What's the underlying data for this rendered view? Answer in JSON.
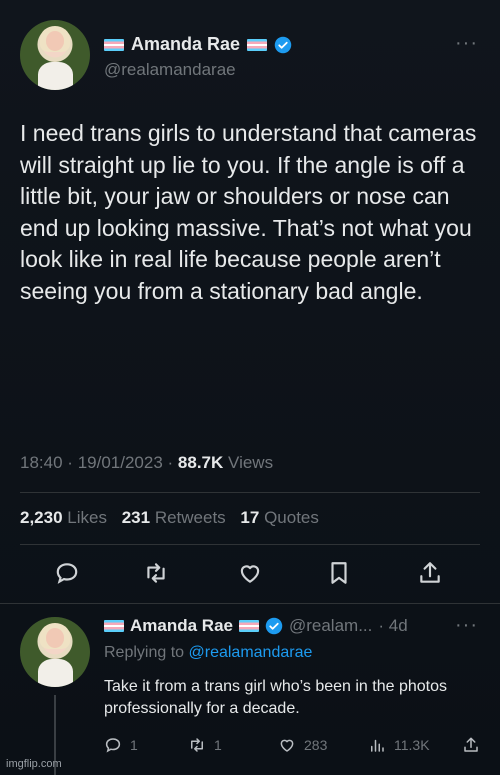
{
  "main_tweet": {
    "display_name": "Amanda Rae",
    "handle": "@realamandarae",
    "text": "I need trans girls to understand that cameras will straight up lie to you. If the angle is off a little bit, your jaw or shoulders or nose can end up looking massive. That’s not what you look like in real life because people aren’t seeing you from a stationary bad angle.",
    "time": "18:40",
    "date": "19/01/2023",
    "views_count": "88.7K",
    "views_label": "Views",
    "likes_count": "2,230",
    "likes_label": "Likes",
    "retweets_count": "231",
    "retweets_label": "Retweets",
    "quotes_count": "17",
    "quotes_label": "Quotes",
    "more_icon": "more-icon",
    "actions": [
      "reply-icon",
      "retweet-icon",
      "like-icon",
      "bookmark-icon",
      "share-icon"
    ]
  },
  "reply": {
    "display_name": "Amanda Rae",
    "handle_truncated": "@realam...",
    "age": "· 4d",
    "replying_prefix": "Replying to",
    "replying_to": "@realamandarae",
    "text": "Take it from a trans girl who’s been in the photos professionally for a decade.",
    "reply_count": "1",
    "retweet_count": "1",
    "like_count": "283",
    "views_count": "11.3K"
  },
  "watermark": "imgflip.com",
  "colors": {
    "background": "#0d1117",
    "text": "#e7e9ea",
    "muted": "#71767b",
    "link": "#1d9bf0",
    "verified": "#1d9bf0",
    "divider": "#2f3336"
  }
}
